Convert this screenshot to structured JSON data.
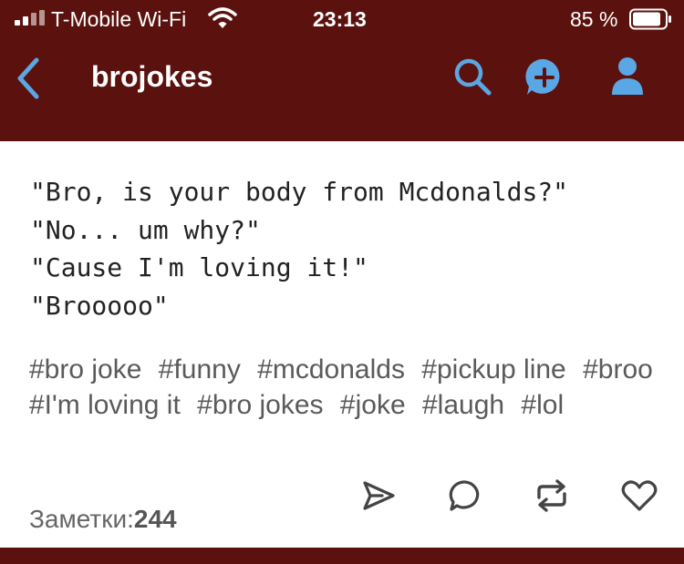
{
  "status_bar": {
    "carrier": "T-Mobile Wi-Fi",
    "time": "23:13",
    "battery": "85 %"
  },
  "nav": {
    "title": "brojokes",
    "accent_color": "#5aa7e6"
  },
  "post": {
    "lines": [
      "\"Bro, is your body from Mcdonalds?\"",
      "\"No... um why?\"",
      "\"Cause I'm loving it!\"",
      "\"Brooooo\""
    ],
    "tags": [
      "#bro joke",
      "#funny",
      "#mcdonalds",
      "#pickup line",
      "#broo",
      "#I'm loving it",
      "#bro jokes",
      "#joke",
      "#laugh",
      "#lol"
    ],
    "notes_label": "Заметки:",
    "notes_count": "244"
  },
  "icons": [
    "back-chevron-icon",
    "search-icon",
    "compose-icon",
    "account-icon",
    "share-icon",
    "reply-icon",
    "reblog-icon",
    "like-icon"
  ]
}
